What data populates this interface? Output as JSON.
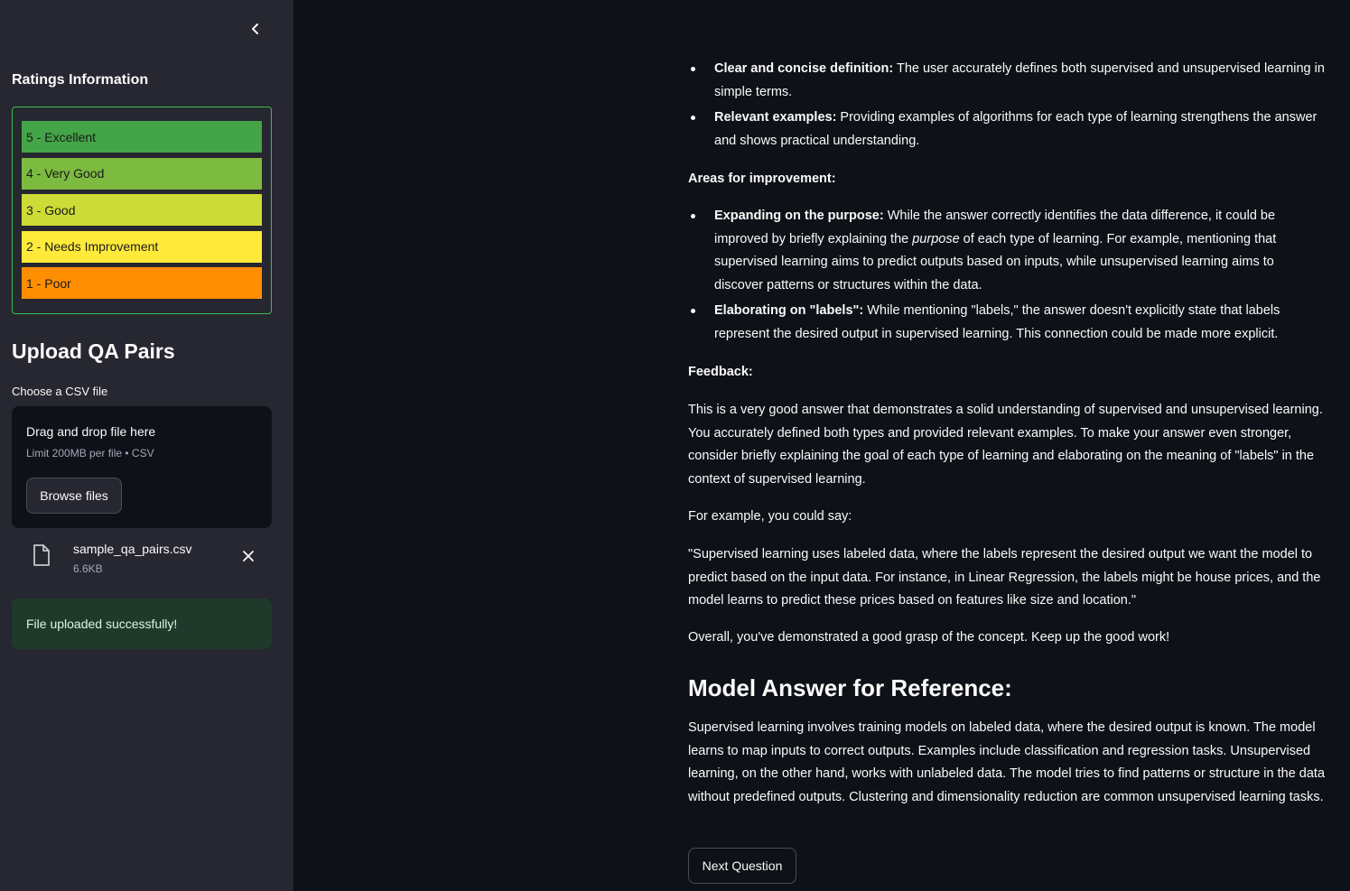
{
  "sidebar": {
    "ratings_heading": "Ratings Information",
    "ratings": [
      {
        "label": "5 - Excellent",
        "color": "#43a547"
      },
      {
        "label": "4 - Very Good",
        "color": "#7cba40"
      },
      {
        "label": "3 - Good",
        "color": "#cddb36"
      },
      {
        "label": "2 - Needs Improvement",
        "color": "#ffea3b"
      },
      {
        "label": "1 - Poor",
        "color": "#ff8f00"
      }
    ],
    "upload_title": "Upload QA Pairs",
    "choose_label": "Choose a CSV file",
    "dropzone": {
      "title": "Drag and drop file here",
      "limit": "Limit 200MB per file • CSV",
      "browse_label": "Browse files"
    },
    "file": {
      "name": "sample_qa_pairs.csv",
      "size": "6.6KB"
    },
    "success_message": "File uploaded successfully!"
  },
  "main": {
    "strengths": [
      {
        "bold": "Clear and concise definition:",
        "text": " The user accurately defines both supervised and unsupervised learning in simple terms."
      },
      {
        "bold": "Relevant examples:",
        "text": " Providing examples of algorithms for each type of learning strengthens the answer and shows practical understanding."
      }
    ],
    "improvement_heading": "Areas for improvement:",
    "improvements": [
      {
        "bold": "Expanding on the purpose:",
        "text_before": " While the answer correctly identifies the data difference, it could be improved by briefly explaining the ",
        "italic": "purpose",
        "text_after": " of each type of learning. For example, mentioning that supervised learning aims to predict outputs based on inputs, while unsupervised learning aims to discover patterns or structures within the data."
      },
      {
        "bold": "Elaborating on \"labels\":",
        "text": " While mentioning \"labels,\" the answer doesn't explicitly state that labels represent the desired output in supervised learning. This connection could be made more explicit."
      }
    ],
    "feedback_heading": "Feedback:",
    "feedback_text": "This is a very good answer that demonstrates a solid understanding of supervised and unsupervised learning. You accurately defined both types and provided relevant examples. To make your answer even stronger, consider briefly explaining the goal of each type of learning and elaborating on the meaning of \"labels\" in the context of supervised learning.",
    "example_intro": "For example, you could say:",
    "example_quote": "\"Supervised learning uses labeled data, where the labels represent the desired output we want the model to predict based on the input data. For instance, in Linear Regression, the labels might be house prices, and the model learns to predict these prices based on features like size and location.\"",
    "overall": "Overall, you've demonstrated a good grasp of the concept. Keep up the good work!",
    "model_heading": "Model Answer for Reference:",
    "model_answer": "Supervised learning involves training models on labeled data, where the desired output is known. The model learns to map inputs to correct outputs. Examples include classification and regression tasks. Unsupervised learning, on the other hand, works with unlabeled data. The model tries to find patterns or structure in the data without predefined outputs. Clustering and dimensionality reduction are common unsupervised learning tasks.",
    "next_button": "Next Question"
  }
}
